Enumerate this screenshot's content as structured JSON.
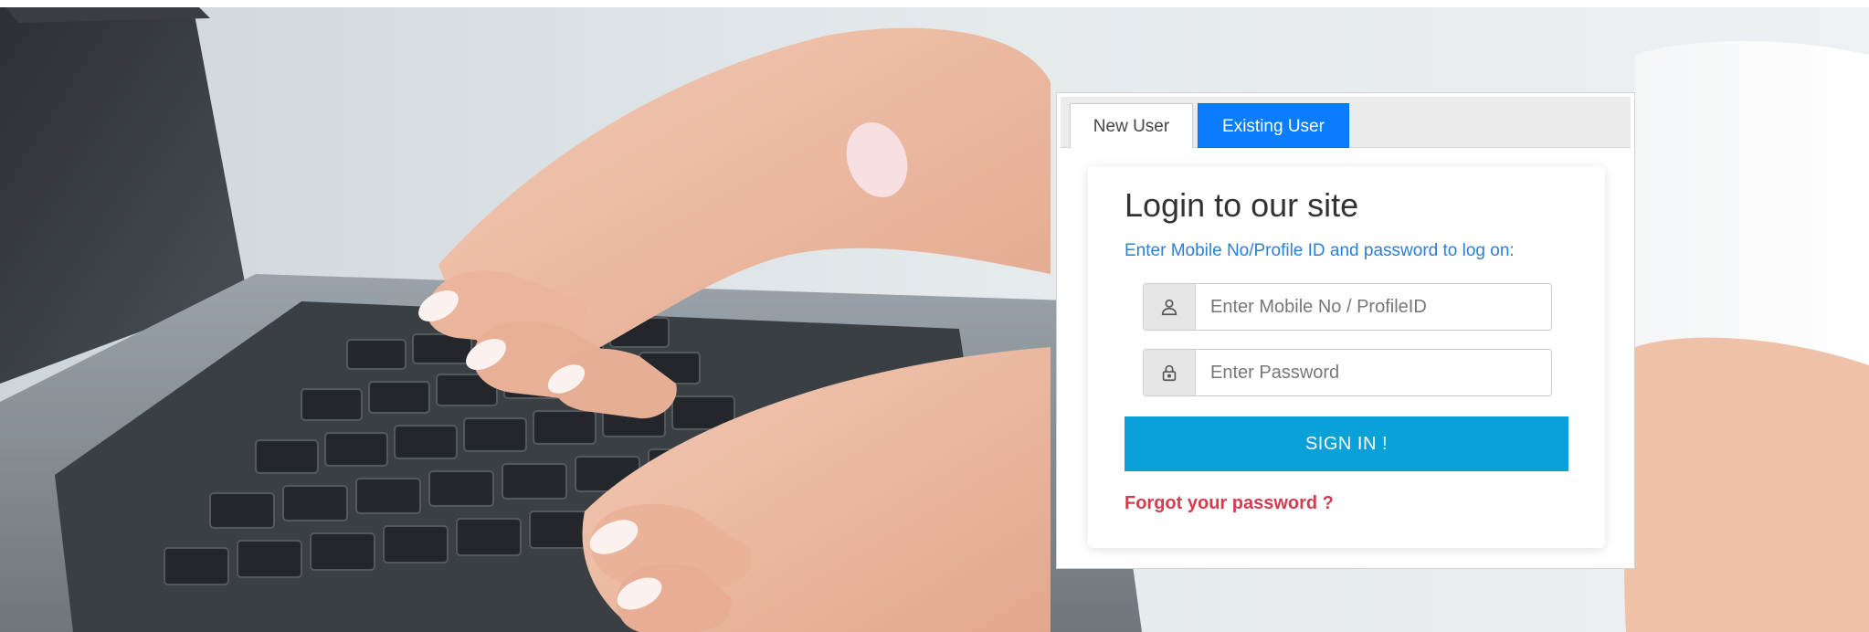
{
  "tabs": {
    "new_user": "New User",
    "existing_user": "Existing User",
    "active": "Existing User"
  },
  "login": {
    "title": "Login to our site",
    "subtitle": "Enter Mobile No/Profile ID and password to log on:",
    "username_placeholder": "Enter Mobile No / ProfileID",
    "username_value": "",
    "password_placeholder": "Enter Password",
    "password_value": "",
    "username_icon": "user-icon",
    "password_icon": "lock-icon",
    "signin_label": "SIGN IN !",
    "forgot_label": "Forgot your password ?"
  },
  "colors": {
    "active_tab": "#0a7dff",
    "signin_button": "#0aa0d8",
    "subtitle": "#2a7fd6",
    "forgot_link": "#d43b4e"
  }
}
